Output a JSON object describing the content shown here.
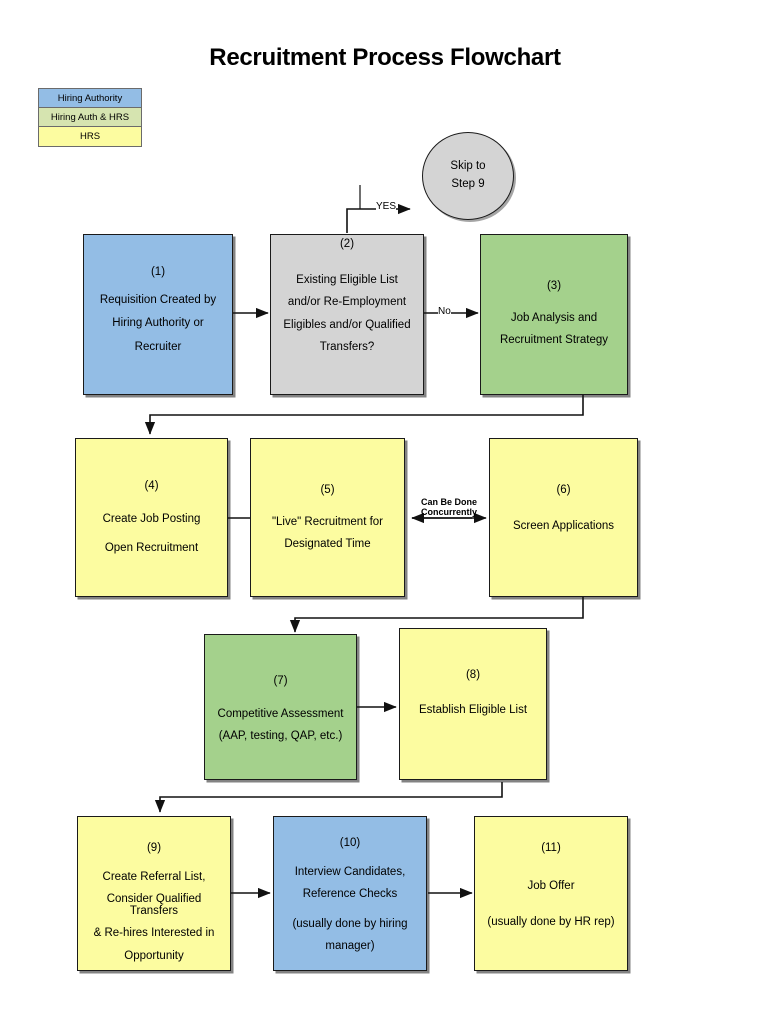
{
  "page": {
    "title": "Recruitment Process Flowchart"
  },
  "legend": {
    "rows": [
      {
        "label": "Hiring Authority",
        "color": "#93bde5"
      },
      {
        "label": "Hiring Auth & HRS",
        "color": "#d6e4b0"
      },
      {
        "label": "HRS",
        "color": "#fcfca0"
      }
    ]
  },
  "nodes": [
    {
      "id": "node-1",
      "number": "(1)",
      "lines": [
        "Requisition Created by",
        "Hiring Authority or",
        "Recruiter"
      ],
      "fill": "#93bde5",
      "owner": "Hiring Authority"
    },
    {
      "id": "node-2",
      "number": "(2)",
      "lines": [
        "Existing Eligible List",
        "and/or Re-Employment",
        "Eligibles and/or Qualified",
        "Transfers?"
      ],
      "fill": "#d4d4d4",
      "owner": "Decision"
    },
    {
      "id": "node-3",
      "number": "(3)",
      "lines": [
        "Job Analysis and",
        "Recruitment Strategy"
      ],
      "fill": "#a4d18c",
      "owner": "Hiring Auth & HRS"
    },
    {
      "id": "node-4",
      "number": "(4)",
      "lines": [
        "Create Job Posting",
        "Open Recruitment"
      ],
      "fill": "#fcfca0",
      "owner": "HRS"
    },
    {
      "id": "node-5",
      "number": "(5)",
      "lines": [
        "\"Live\" Recruitment for",
        "Designated Time"
      ],
      "fill": "#fcfca0",
      "owner": "HRS"
    },
    {
      "id": "node-6",
      "number": "(6)",
      "lines": [
        "Screen Applications"
      ],
      "fill": "#fcfca0",
      "owner": "HRS"
    },
    {
      "id": "node-7",
      "number": "(7)",
      "lines": [
        "Competitive Assessment",
        "(AAP, testing, QAP, etc.)"
      ],
      "fill": "#a4d18c",
      "owner": "Hiring Auth & HRS"
    },
    {
      "id": "node-8",
      "number": "(8)",
      "lines": [
        "Establish Eligible List"
      ],
      "fill": "#fcfca0",
      "owner": "HRS"
    },
    {
      "id": "node-9",
      "number": "(9)",
      "lines": [
        "Create Referral List,",
        "Consider Qualified Transfers",
        "& Re-hires Interested in",
        "Opportunity"
      ],
      "fill": "#fcfca0",
      "owner": "HRS"
    },
    {
      "id": "node-10",
      "number": "(10)",
      "lines": [
        "Interview Candidates,",
        "Reference Checks",
        "",
        "(usually done by hiring",
        "manager)"
      ],
      "fill": "#93bde5",
      "owner": "Hiring Authority"
    },
    {
      "id": "node-11",
      "number": "(11)",
      "lines": [
        "Job Offer",
        "",
        "(usually done by HR rep)"
      ],
      "fill": "#fcfca0",
      "owner": "HRS"
    }
  ],
  "terminator": {
    "lines": [
      "Skip to",
      "Step 9"
    ]
  },
  "edge_labels": {
    "yes": "YES",
    "no": "No",
    "concurrent_line1": "Can Be Done",
    "concurrent_line2": "Concurrently"
  }
}
